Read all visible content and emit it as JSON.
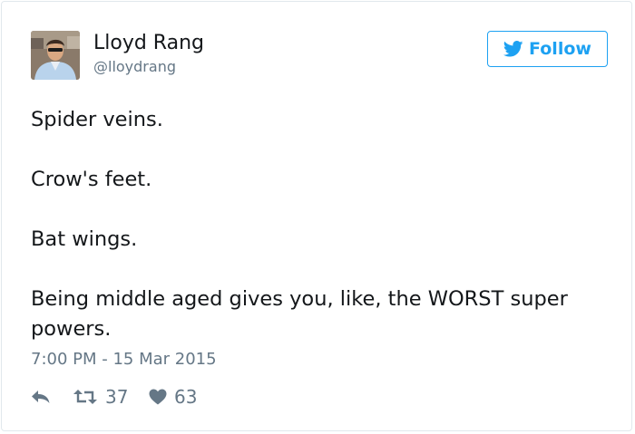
{
  "user": {
    "display_name": "Lloyd Rang",
    "handle": "@lloydrang",
    "avatar_icon": "profile-photo"
  },
  "follow_button": {
    "label": "Follow",
    "icon": "twitter-bird-icon",
    "color": "#1da1f2"
  },
  "tweet": {
    "lines": [
      "Spider veins.",
      "Crow's feet.",
      "Bat wings.",
      "Being middle aged gives you, like, the WORST super powers."
    ]
  },
  "timestamp": "7:00 PM - 15 Mar 2015",
  "actions": {
    "reply_icon": "reply-icon",
    "retweet_icon": "retweet-icon",
    "retweet_count": "37",
    "like_icon": "heart-icon",
    "like_count": "63"
  },
  "colors": {
    "text": "#14171a",
    "secondary": "#657786",
    "border": "#e1e8ed"
  }
}
